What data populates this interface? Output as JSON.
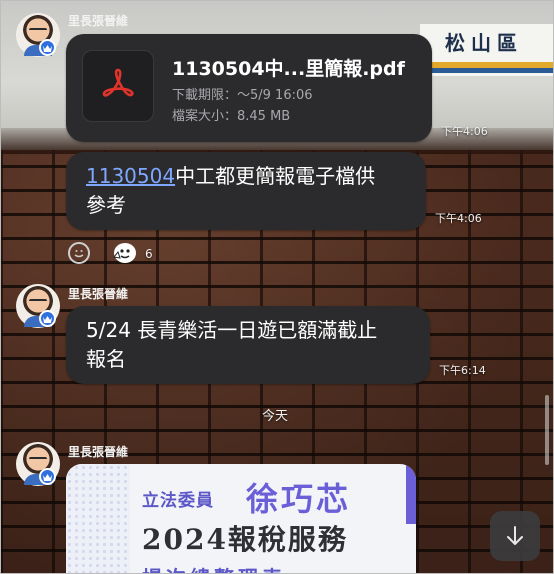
{
  "sign": {
    "text": "松山區"
  },
  "messages": [
    {
      "sender": "里長張晉維",
      "file": {
        "name": "1130504中...里簡報.pdf",
        "expiry": "下載期限：～5/9 16:06",
        "size": "檔案大小：8.45 MB",
        "icon": "pdf-icon"
      },
      "time": "下午4:06"
    },
    {
      "text_link": "1130504",
      "text_line1": "中工都更簡報電子檔供",
      "text_line2": "參考",
      "time": "下午4:06",
      "reaction_count": "6"
    },
    {
      "sender": "里長張晉維",
      "text_line1": "5/24 長青樂活一日遊已額滿截止",
      "text_line2": "報名",
      "time": "下午6:14"
    },
    {
      "sender": "里長張晉維",
      "promo": {
        "subtitle": "立法委員",
        "name": "徐巧芯",
        "title": "2024報稅服務",
        "cut_text": "場次總整理表"
      }
    }
  ],
  "date_divider": "今天",
  "colors": {
    "bubble": "#2b2b2d",
    "link": "#7fa7ff",
    "badge": "#2f6fe0",
    "promo_accent": "#6a5fd6"
  }
}
